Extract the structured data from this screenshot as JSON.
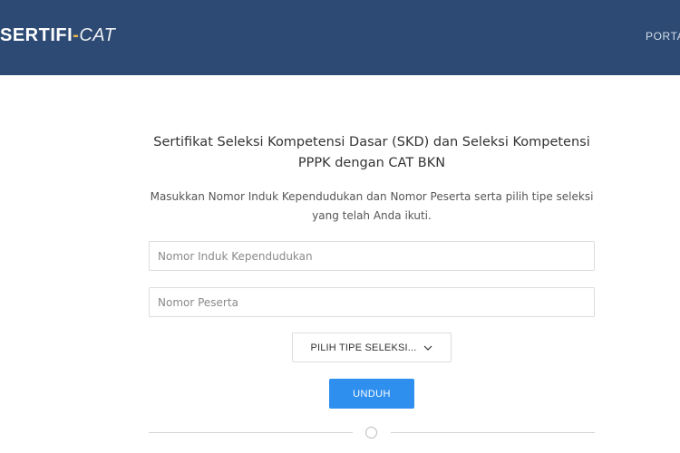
{
  "header": {
    "logo": {
      "main": "SERTIFI",
      "dash": "-",
      "accent": "CAT"
    },
    "nav_link": "PORTAL"
  },
  "form": {
    "title": "Sertifikat Seleksi Kompetensi Dasar (SKD) dan Seleksi Kompetensi PPPK dengan CAT BKN",
    "subtitle": "Masukkan Nomor Induk Kependudukan dan Nomor Peserta serta pilih tipe seleksi yang telah Anda ikuti.",
    "nik_placeholder": "Nomor Induk Kependudukan",
    "nik_value": "",
    "peserta_placeholder": "Nomor Peserta",
    "peserta_value": "",
    "select_label": "PILIH TIPE SELEKSI...",
    "download_label": "UNDUH"
  },
  "colors": {
    "header_bg": "#2c4a73",
    "logo_dash": "#e8b84a",
    "primary_button": "#2f8fef"
  },
  "icons": {
    "select_chevron": "chevron-down-icon",
    "divider_marker": "circle-icon"
  }
}
